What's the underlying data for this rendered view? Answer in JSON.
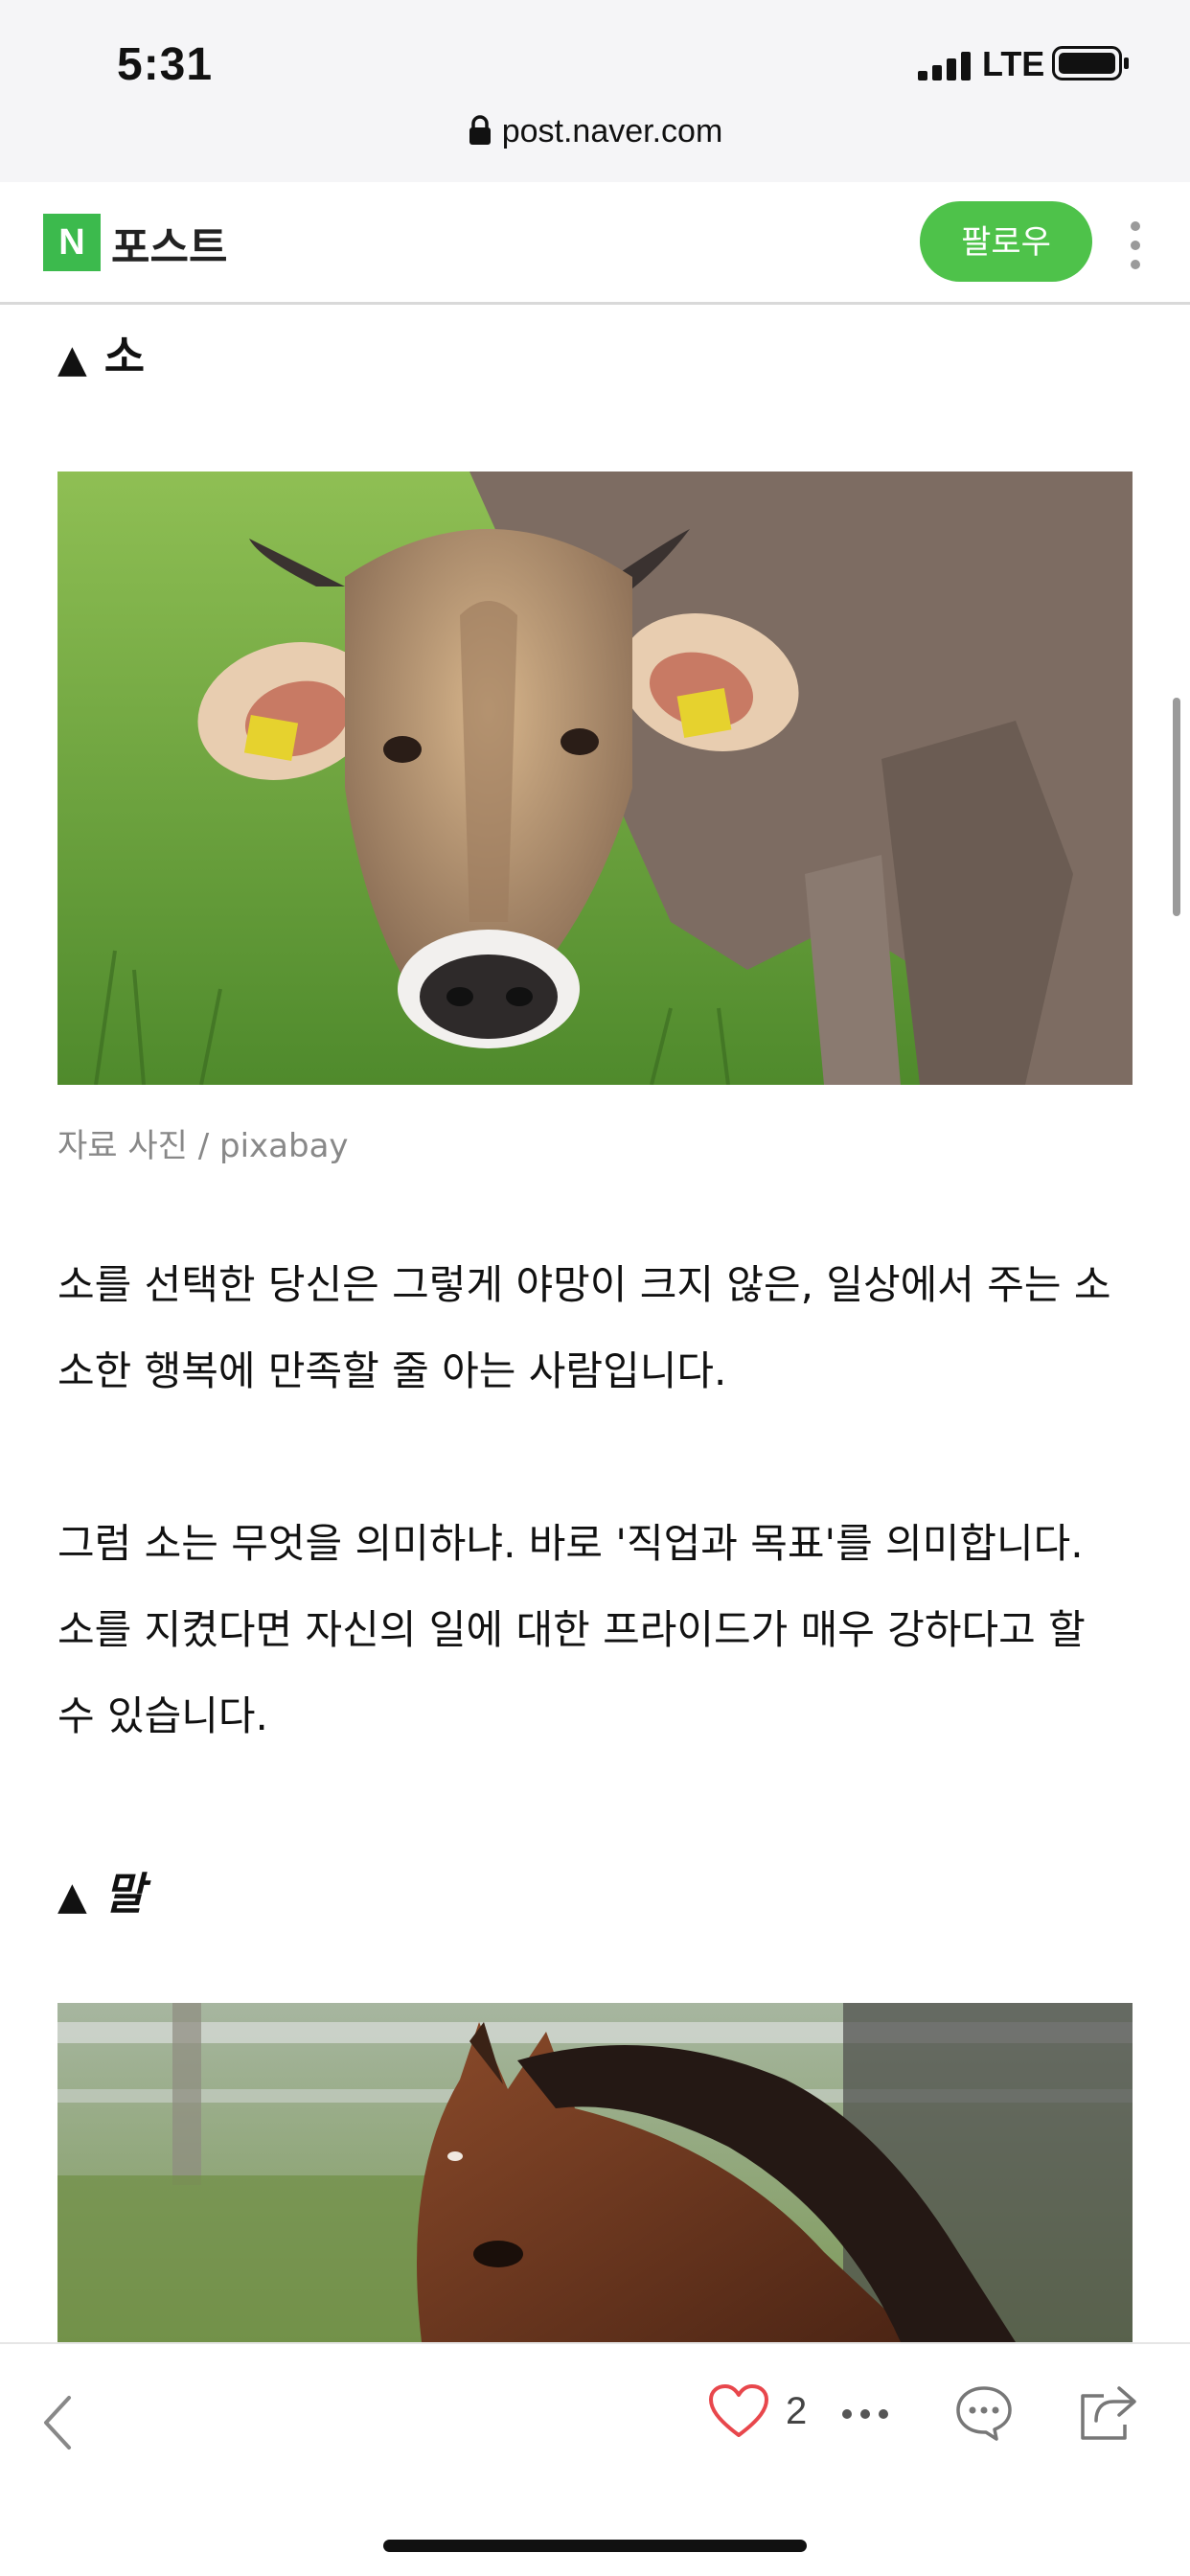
{
  "status_bar": {
    "time": "5:31",
    "network": "LTE",
    "icons": [
      "signal-bars-icon",
      "battery-icon"
    ]
  },
  "browser": {
    "url": "post.naver.com",
    "icon": "lock-icon"
  },
  "header": {
    "logo_letter": "N",
    "title": "포스트",
    "follow_label": "팔로우",
    "brand_color": "#3cba4d",
    "follow_color": "#4ec24a",
    "more_icon": "more-vertical-icon"
  },
  "article": {
    "section1": {
      "marker": "▲",
      "heading": "소",
      "image": "cow-photo",
      "caption": "자료 사진 / pixabay",
      "paragraph1": "소를 선택한 당신은 그렇게 야망이 크지 않은, 일상에서 주는 소소한 행복에 만족할 줄 아는 사람입니다.",
      "paragraph2": "그럼 소는 무엇을 의미하냐. 바로 '직업과 목표'를 의미합니다. 소를 지켰다면 자신의 일에 대한 프라이드가 매우 강하다고 할 수 있습니다."
    },
    "section2": {
      "marker": "▲",
      "heading": "말",
      "image": "horse-photo"
    }
  },
  "toolbar": {
    "like_count": "2",
    "icons": [
      "back-icon",
      "heart-icon",
      "more-horizontal-icon",
      "comment-icon",
      "share-icon"
    ],
    "heart_color": "#e8474c"
  }
}
